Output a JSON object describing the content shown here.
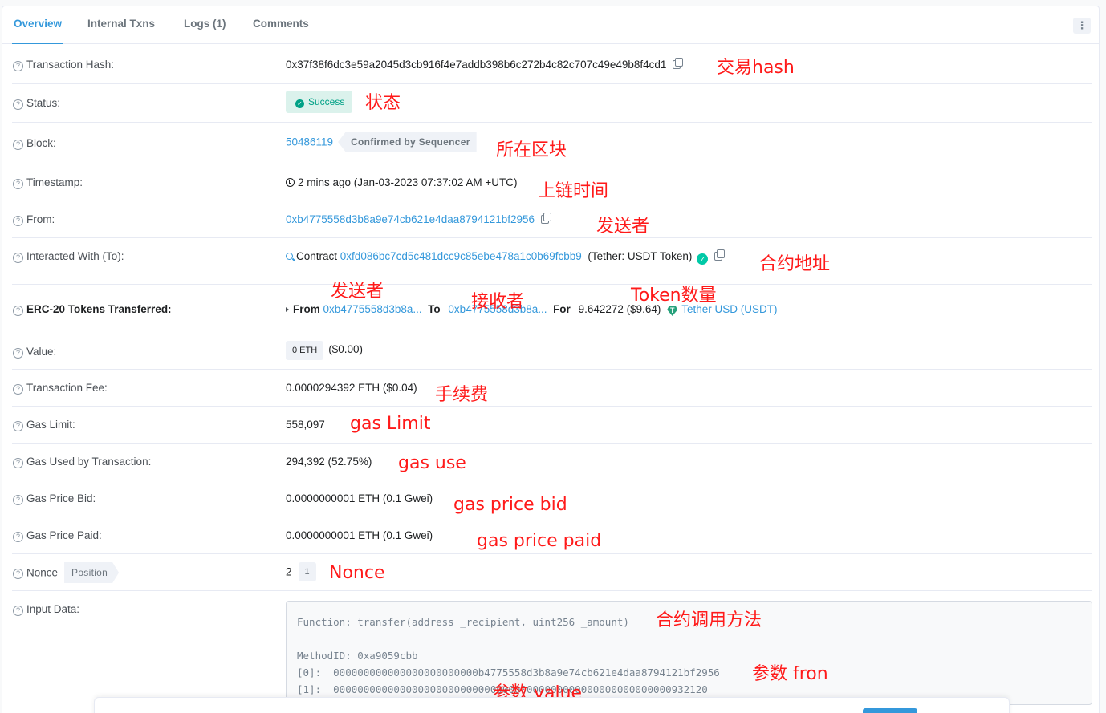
{
  "tabs": [
    "Overview",
    "Internal Txns",
    "Logs (1)",
    "Comments"
  ],
  "more_icon": "⋮",
  "rows": {
    "tx_hash": {
      "label": "Transaction Hash:",
      "value": "0x37f38f6dc3e59a2045d3cb916f4e7addb398b6c272b4c82c707c49e49b8f4cd1"
    },
    "status": {
      "label": "Status:",
      "value": "Success"
    },
    "block": {
      "label": "Block:",
      "value": "50486119",
      "badge": "Confirmed by Sequencer"
    },
    "timestamp": {
      "label": "Timestamp:",
      "value": "2 mins ago (Jan-03-2023 07:37:02 AM +UTC)"
    },
    "from": {
      "label": "From:",
      "value": "0xb4775558d3b8a9e74cb621e4daa8794121bf2956"
    },
    "to": {
      "label": "Interacted With (To):",
      "prefix": "Contract",
      "address": "0xfd086bc7cd5c481dcc9c85ebe478a1c0b69fcbb9",
      "name": "(Tether: USDT Token)"
    },
    "erc20": {
      "label": "ERC-20 Tokens Transferred:",
      "from_label": "From",
      "from": "0xb4775558d3b8a...",
      "to_label": "To",
      "to": "0xb4775558d3b8a...",
      "for_label": "For",
      "amount": "9.642272",
      "usd": "($9.64)",
      "token": "Tether USD (USDT)"
    },
    "value": {
      "label": "Value:",
      "eth": "0 ETH",
      "usd": "($0.00)"
    },
    "fee": {
      "label": "Transaction Fee:",
      "value": "0.0000294392 ETH ($0.04)"
    },
    "gas_limit": {
      "label": "Gas Limit:",
      "value": "558,097"
    },
    "gas_used": {
      "label": "Gas Used by Transaction:",
      "value": "294,392 (52.75%)"
    },
    "gas_bid": {
      "label": "Gas Price Bid:",
      "value": "0.0000000001 ETH (0.1 Gwei)"
    },
    "gas_paid": {
      "label": "Gas Price Paid:",
      "value": "0.0000000001 ETH (0.1 Gwei)"
    },
    "nonce": {
      "label": "Nonce",
      "badge": "Position",
      "value": "2",
      "position": "1"
    },
    "input": {
      "label": "Input Data:",
      "function": "Function: transfer(address _recipient, uint256 _amount)",
      "method": "MethodID: 0xa9059cbb",
      "arg0": "[0]:  000000000000000000000000b4775558d3b8a9e74cb621e4daa8794121bf2956",
      "arg1": "[1]:  00000000000000000000000000000000000000000000000000000000932120"
    }
  },
  "annotations": {
    "tx_hash": "交易hash",
    "status": "状态",
    "block": "所在区块",
    "timestamp": "上链时间",
    "from": "发送者",
    "to": "合约地址",
    "erc20_from": "发送者",
    "erc20_to": "接收者",
    "erc20_amount": "Token数量",
    "fee": "手续费",
    "gas_limit": "gas Limit",
    "gas_used": "gas use",
    "gas_bid": "gas price bid",
    "gas_paid": "gas price paid",
    "nonce": "Nonce",
    "input_function": "合约调用方法",
    "input_from": "参数 fron",
    "input_value": "参数 value"
  },
  "colors": {
    "link": "#3498db",
    "success": "#00a186",
    "annotation": "#ff1a1a"
  }
}
